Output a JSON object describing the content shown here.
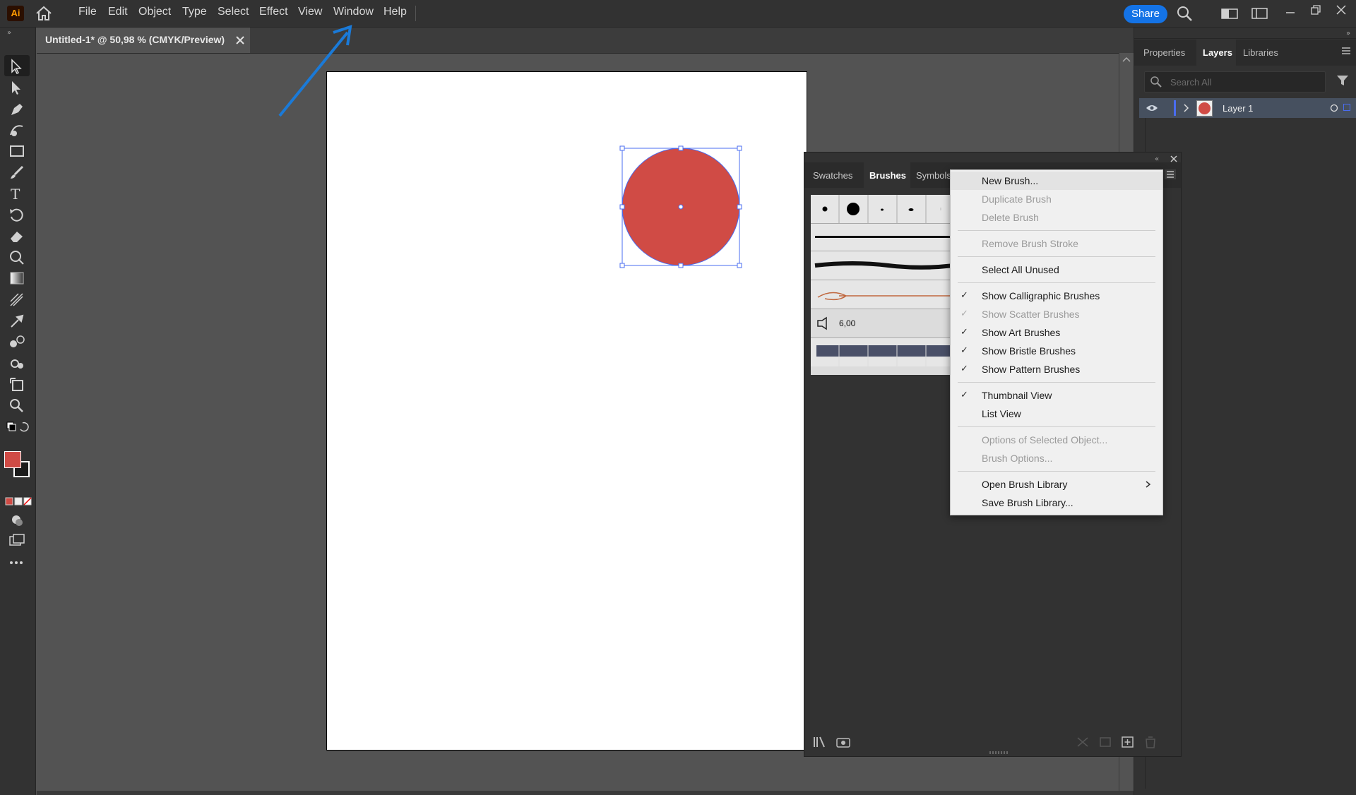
{
  "app": {
    "logo": "Ai"
  },
  "menubar": {
    "items": [
      "File",
      "Edit",
      "Object",
      "Type",
      "Select",
      "Effect",
      "View",
      "Window",
      "Help"
    ],
    "share_label": "Share"
  },
  "document": {
    "tab_title": "Untitled-1* @ 50,98 % (CMYK/Preview)"
  },
  "right_panel": {
    "tabs": [
      "Properties",
      "Layers",
      "Libraries"
    ],
    "active_tab": "Layers",
    "search_placeholder": "Search All",
    "layers": [
      {
        "name": "Layer 1"
      }
    ]
  },
  "brushes_panel": {
    "tabs": [
      "Swatches",
      "Brushes",
      "Symbols"
    ],
    "active_tab": "Brushes",
    "brush_size": "6,00"
  },
  "flyout_menu": {
    "items": [
      {
        "label": "New Brush...",
        "enabled": true,
        "checked": false
      },
      {
        "label": "Duplicate Brush",
        "enabled": false,
        "checked": false
      },
      {
        "label": "Delete Brush",
        "enabled": false,
        "checked": false
      },
      {
        "label": "Remove Brush Stroke",
        "enabled": false,
        "checked": false
      },
      {
        "label": "Select All Unused",
        "enabled": true,
        "checked": false
      },
      {
        "label": "Show Calligraphic Brushes",
        "enabled": true,
        "checked": true
      },
      {
        "label": "Show Scatter Brushes",
        "enabled": false,
        "checked": true
      },
      {
        "label": "Show Art Brushes",
        "enabled": true,
        "checked": true
      },
      {
        "label": "Show Bristle Brushes",
        "enabled": true,
        "checked": true
      },
      {
        "label": "Show Pattern Brushes",
        "enabled": true,
        "checked": true
      },
      {
        "label": "Thumbnail View",
        "enabled": true,
        "checked": true
      },
      {
        "label": "List View",
        "enabled": true,
        "checked": false
      },
      {
        "label": "Options of Selected Object...",
        "enabled": false,
        "checked": false
      },
      {
        "label": "Brush Options...",
        "enabled": false,
        "checked": false
      },
      {
        "label": "Open Brush Library",
        "enabled": true,
        "checked": false,
        "submenu": true
      },
      {
        "label": "Save Brush Library...",
        "enabled": true,
        "checked": false
      }
    ]
  },
  "colors": {
    "accent": "#1473e6",
    "selection": "#4a6cf0",
    "circle_fill": "#d04b45",
    "annotation_arrow": "#1a7ad8"
  },
  "icons": [
    "home-icon",
    "search-icon",
    "arrange-documents-icon",
    "workspace-icon",
    "minimize-icon",
    "restore-icon",
    "close-icon",
    "eye-icon",
    "filter-icon",
    "panel-menu-icon"
  ]
}
